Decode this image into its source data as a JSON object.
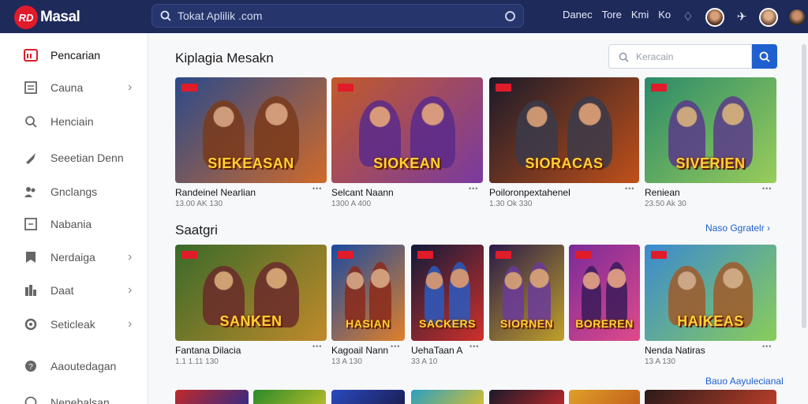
{
  "header": {
    "logo_mark": "RD",
    "logo_text": "Masal",
    "search_placeholder": "Tokat Aplilik .com",
    "links": [
      "Danec",
      "Tore",
      "Kmi",
      "Ko"
    ]
  },
  "sidebar": {
    "items": [
      {
        "label": "Pencarian",
        "icon": "home-icon",
        "chevron": false,
        "active": true
      },
      {
        "label": "Cauna",
        "icon": "grid-icon",
        "chevron": true,
        "active": false
      },
      {
        "label": "Henciain",
        "icon": "search-icon",
        "chevron": false,
        "active": false
      },
      {
        "label": "Seeetian Denn",
        "icon": "tag-icon",
        "chevron": false,
        "active": false
      },
      {
        "label": "Gnclangs",
        "icon": "users-icon",
        "chevron": false,
        "active": false
      },
      {
        "label": "Nabania",
        "icon": "box-icon",
        "chevron": false,
        "active": false
      },
      {
        "label": "Nerdaiga",
        "icon": "bookmark-icon",
        "chevron": true,
        "active": false
      },
      {
        "label": "Daat",
        "icon": "chart-icon",
        "chevron": true,
        "active": false
      },
      {
        "label": "Seticleak",
        "icon": "settings-icon",
        "chevron": true,
        "active": false
      },
      {
        "label": "Aaoutedagan",
        "icon": "help-icon",
        "chevron": false,
        "active": false
      },
      {
        "label": "Nenebalsan",
        "icon": "clock-icon",
        "chevron": false,
        "active": false
      }
    ]
  },
  "section1": {
    "title": "Kiplagia Mesakn",
    "filter_placeholder": "Keracain",
    "cards": [
      {
        "name": "Randeinel Nearlian",
        "meta": "13.00 AK 130",
        "art": "SIEKEASAN",
        "c1": "#2a4a8a",
        "c2": "#d06a2a",
        "accent": "#7a3a1a"
      },
      {
        "name": "Selcant Naann",
        "meta": "1300 A 400",
        "art": "SIOKEAN",
        "c1": "#c25a2a",
        "c2": "#7a3aa0",
        "accent": "#5a2a8a"
      },
      {
        "name": "Poiloronpextahenel",
        "meta": "1.30 Ok 330",
        "art": "SIORACAS",
        "c1": "#1a1a2a",
        "c2": "#c0501a",
        "accent": "#3a3a4a"
      },
      {
        "name": "Reniean",
        "meta": "23.50 Ak 30",
        "art": "SIVERIEN",
        "c1": "#2a8a6a",
        "c2": "#9acd5a",
        "accent": "#5a3a8a"
      }
    ]
  },
  "section2": {
    "title": "Saatgri",
    "see_all": "Naso Ggratelr",
    "cards": [
      {
        "name": "Fantana Dilacia",
        "meta": "1.1 1.11 130",
        "art": "SANKEN",
        "c1": "#3a6a2a",
        "c2": "#c08a2a",
        "accent": "#6a2a2a"
      },
      {
        "name": "Kagoail Nann",
        "meta": "13 A 130",
        "art": "HASIAN",
        "c1": "#1a4aa0",
        "c2": "#e0802a",
        "accent": "#8a2a1a"
      },
      {
        "name": "UehaTaan A",
        "meta": "33 A 10",
        "art": "SACKERS",
        "c1": "#101a3a",
        "c2": "#d0302a",
        "accent": "#2a5ac0"
      },
      {
        "name": "",
        "meta": "",
        "art": "SIORNEN",
        "c1": "#2a1a4a",
        "c2": "#c0a02a",
        "accent": "#6a3a9a"
      },
      {
        "name": "",
        "meta": "",
        "art": "BOREREN",
        "c1": "#7a2a9a",
        "c2": "#e04a8a",
        "accent": "#3a1a5a"
      },
      {
        "name": "Nenda Natiras",
        "meta": "13 A 130",
        "art": "HAIKEAS",
        "c1": "#3a8ad0",
        "c2": "#8acd5a",
        "accent": "#a05a2a"
      }
    ]
  },
  "section3": {
    "see_all": "Bauo Aayulecianal",
    "thumbs": [
      {
        "c1": "#c02a2a",
        "c2": "#2a2a8a"
      },
      {
        "c1": "#2a8a2a",
        "c2": "#c0c02a"
      },
      {
        "c1": "#2a4ac0",
        "c2": "#1a1a4a"
      },
      {
        "c1": "#2aa0c0",
        "c2": "#e0c02a"
      },
      {
        "c1": "#1a1a2a",
        "c2": "#c02a2a"
      },
      {
        "c1": "#e0a02a",
        "c2": "#c05a1a"
      },
      {
        "c1": "#2a1a1a",
        "c2": "#c0402a"
      }
    ]
  }
}
